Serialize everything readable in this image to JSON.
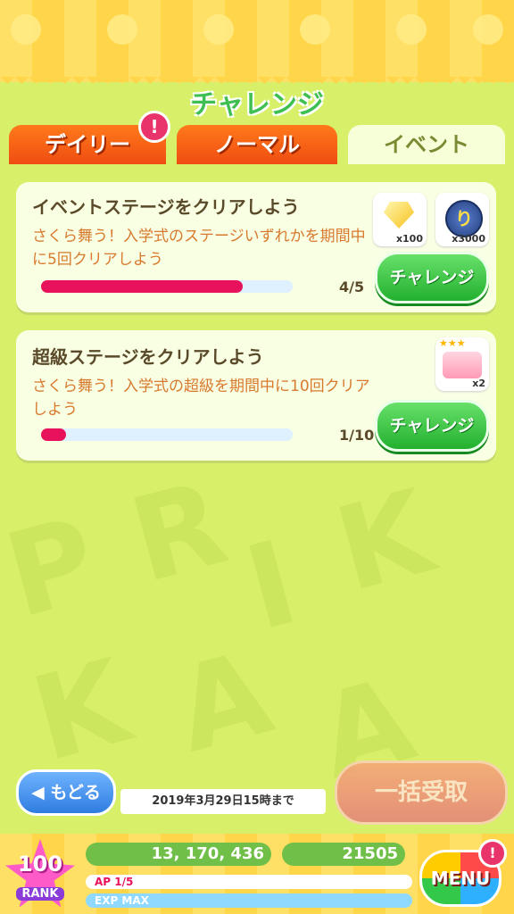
{
  "title": "チャレンジ",
  "tabs": [
    {
      "label": "デイリー",
      "badge": "!"
    },
    {
      "label": "ノーマル"
    },
    {
      "label": "イベント"
    }
  ],
  "missions": [
    {
      "title": "イベントステージをクリアしよう",
      "description": "さくら舞う！入学式のステージいずれかを期間中に5回クリアしよう",
      "progress_text": "4/5",
      "progress": 0.8,
      "button": "チャレンジ",
      "rewards": [
        {
          "icon": "gem-icon",
          "quantity": "x100"
        },
        {
          "icon": "coin-icon",
          "quantity": "x3000"
        }
      ]
    },
    {
      "title": "超級ステージをクリアしよう",
      "description": "さくら舞う！入学式の超級を期間中に10回クリアしよう",
      "progress_text": "1/10",
      "progress": 0.1,
      "button": "チャレンジ",
      "rewards": [
        {
          "icon": "ticket-icon",
          "quantity": "x2"
        }
      ]
    }
  ],
  "back_button": "もどる",
  "deadline": "2019年3月29日15時まで",
  "bulk_receive": "一括受取",
  "status": {
    "rank_value": "100",
    "rank_label": "RANK",
    "coins": "13, 170, 436",
    "gems": "21505",
    "ap": "AP 1/5",
    "exp": "EXP MAX"
  },
  "menu": {
    "label": "MENU",
    "badge": "!"
  },
  "colors": {
    "accent_green": "#3fbf52",
    "tab_orange": "#ef4c12",
    "progress_pink": "#e8125c"
  }
}
